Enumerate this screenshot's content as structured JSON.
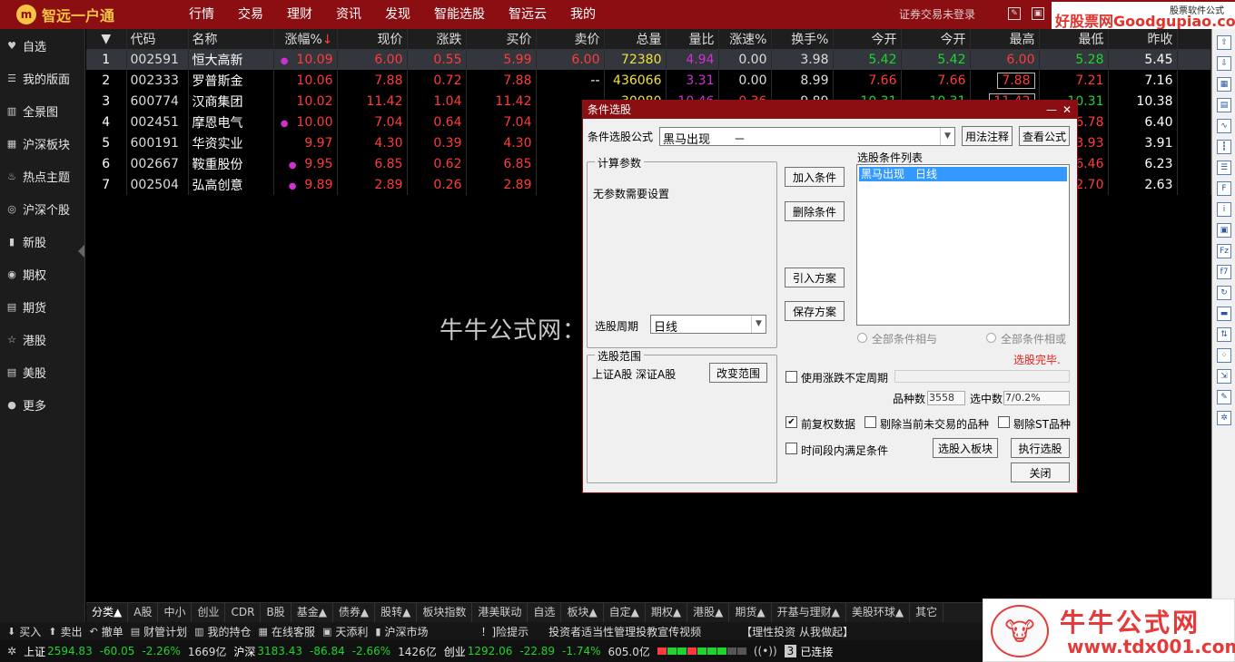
{
  "topbar": {
    "logo_text": "智远一户通",
    "menu": [
      "行情",
      "交易",
      "理财",
      "资讯",
      "发现",
      "智能选股",
      "智远云",
      "我的"
    ],
    "login_status": "证券交易未登录",
    "brand_main": "好股票网Goodgupiao.com",
    "brand_sub": "股票软件公式"
  },
  "sidebar": {
    "items": [
      {
        "label": "自选",
        "icon": "heart-icon"
      },
      {
        "label": "我的版面",
        "icon": "layout-icon"
      },
      {
        "label": "全景图",
        "icon": "panorama-icon"
      },
      {
        "label": "沪深板块",
        "icon": "sector-icon"
      },
      {
        "label": "热点主题",
        "icon": "flame-icon"
      },
      {
        "label": "沪深个股",
        "icon": "signal-icon"
      },
      {
        "label": "新股",
        "icon": "bar-chart-icon"
      },
      {
        "label": "期权",
        "icon": "option-icon"
      },
      {
        "label": "期货",
        "icon": "futures-icon"
      },
      {
        "label": "港股",
        "icon": "star-icon"
      },
      {
        "label": "美股",
        "icon": "list-icon"
      },
      {
        "label": "更多",
        "icon": "more-icon"
      }
    ]
  },
  "table": {
    "headers": [
      "",
      "代码",
      "名称",
      "涨幅%",
      "现价",
      "涨跌",
      "买价",
      "卖价",
      "总量",
      "量比",
      "涨速%",
      "换手%",
      "今开",
      "今开",
      "最高",
      "最低",
      "昨收"
    ],
    "rows": [
      [
        "1",
        "002591",
        "恒大高新",
        "10.09",
        "6.00",
        "0.55",
        "5.99",
        "6.00",
        "72380",
        "4.94",
        "0.00",
        "3.98",
        "5.42",
        "5.42",
        "6.00",
        "5.28",
        "5.45"
      ],
      [
        "2",
        "002333",
        "罗普斯金",
        "10.06",
        "7.88",
        "0.72",
        "7.88",
        "--",
        "436066",
        "3.31",
        "0.00",
        "8.99",
        "7.66",
        "7.66",
        "7.88",
        "7.21",
        "7.16"
      ],
      [
        "3",
        "600774",
        "汉商集团",
        "10.02",
        "11.42",
        "1.04",
        "11.42",
        "--",
        "30080",
        "10.46",
        "0.36",
        "9.89",
        "10.31",
        "10.31",
        "11.42",
        "10.31",
        "10.38"
      ],
      [
        "4",
        "002451",
        "摩恩电气",
        "10.00",
        "7.04",
        "0.64",
        "7.04",
        "--",
        "",
        "",
        "",
        "",
        "",
        "",
        "",
        "6.78",
        "6.40"
      ],
      [
        "5",
        "600191",
        "华资实业",
        "9.97",
        "4.30",
        "0.39",
        "4.30",
        "--",
        "",
        "",
        "",
        "",
        "",
        "",
        "",
        "3.93",
        "3.91"
      ],
      [
        "6",
        "002667",
        "鞍重股份",
        "9.95",
        "6.85",
        "0.62",
        "6.85",
        "--",
        "",
        "",
        "",
        "",
        "",
        "",
        "",
        "6.46",
        "6.23"
      ],
      [
        "7",
        "002504",
        "弘高创意",
        "9.89",
        "2.89",
        "0.26",
        "2.89",
        "--",
        "",
        "",
        "",
        "",
        "",
        "",
        "",
        "2.70",
        "2.63"
      ]
    ]
  },
  "watermark": "牛牛公式网：tdx001.com",
  "dialog": {
    "title": "条件选股",
    "formula_label": "条件选股公式",
    "formula_value": "黑马出现　　－",
    "btn_usage": "用法注释",
    "btn_view": "查看公式",
    "params_legend": "计算参数",
    "params_text": "无参数需要设置",
    "period_label": "选股周期",
    "period_value": "日线",
    "range_legend": "选股范围",
    "range_text": "上证A股  深证A股",
    "btn_change_range": "改变范围",
    "btn_add": "加入条件",
    "btn_delete": "删除条件",
    "btn_import": "引入方案",
    "btn_save": "保存方案",
    "list_label": "选股条件列表",
    "list_items": [
      "黑马出现　日线"
    ],
    "radio_and": "全部条件相与",
    "radio_or": "全部条件相或",
    "done_text": "选股完毕.",
    "chk_period": "使用涨跌不定周期",
    "count_label": "品种数",
    "count_value": "3558",
    "selected_label": "选中数",
    "selected_value": "7/0.2%",
    "chk_adjust": "前复权数据",
    "chk_exclude_untraded": "剔除当前未交易的品种",
    "chk_exclude_st": "剔除ST品种",
    "chk_time": "时间段内满足条件",
    "btn_to_block": "选股入板块",
    "btn_run": "执行选股",
    "btn_close": "关闭"
  },
  "bottom_tabs": [
    "分类▲",
    "A股",
    "中小",
    "创业",
    "CDR",
    "B股",
    "基金▲",
    "债券▲",
    "股转▲",
    "板块指数",
    "港美联动",
    "自选",
    "板块▲",
    "自定▲",
    "期权▲",
    "港股▲",
    "期货▲",
    "开基与理财▲",
    "美股环球▲",
    "其它"
  ],
  "bottom_tools": [
    {
      "label": "买入",
      "icon": "buy-icon"
    },
    {
      "label": "卖出",
      "icon": "sell-icon"
    },
    {
      "label": "撤单",
      "icon": "undo-icon"
    },
    {
      "label": "财管计划",
      "icon": "plan-icon"
    },
    {
      "label": "我的持仓",
      "icon": "holdings-icon"
    },
    {
      "label": "在线客服",
      "icon": "service-icon"
    },
    {
      "label": "天添利",
      "icon": "coin-icon"
    },
    {
      "label": "沪深市场",
      "icon": "market-icon"
    }
  ],
  "bottom_notices": [
    "！]险提示",
    "投资者适当性管理投教宣传视频",
    "【理性投资 从我做起】"
  ],
  "status": {
    "sh_label": "上证",
    "sh_value": "2594.83",
    "sh_change": "-60.05",
    "sh_pct": "-2.26%",
    "sh_amount": "1669亿",
    "hs_label": "沪深",
    "hs_value": "3183.43",
    "hs_change": "-86.84",
    "hs_pct": "-2.66%",
    "hs_amount": "1426亿",
    "cy_label": "创业",
    "cy_value": "1292.06",
    "cy_change": "-22.89",
    "cy_pct": "-1.74%",
    "cy_amount": "605.0亿",
    "conn_count": "3",
    "conn_text": "已连接"
  },
  "brand2": {
    "name": "牛牛公式网",
    "url": "www.tdx001.com"
  }
}
